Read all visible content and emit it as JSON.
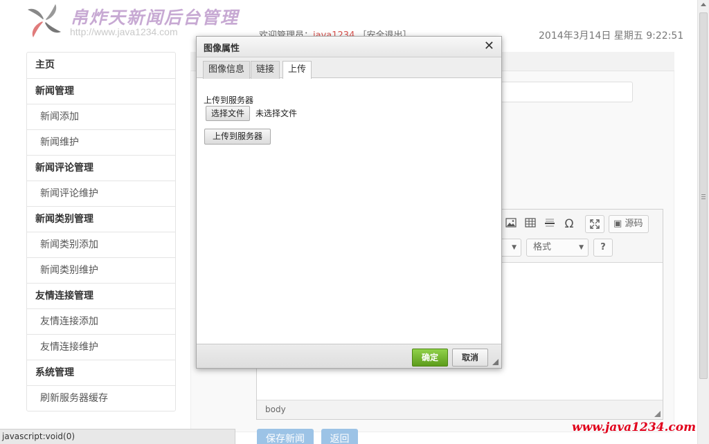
{
  "header": {
    "site_title": "帛炸天新闻后台管理",
    "site_url": "http://www.java1234.com",
    "welcome_prefix": "欢迎管理员：",
    "username": "java1234",
    "logout": "［安全退出］",
    "datetime": "2014年3月14日 星期五 9:22:51"
  },
  "sidebar": {
    "items": [
      {
        "label": "主页",
        "type": "group"
      },
      {
        "label": "新闻管理",
        "type": "group"
      },
      {
        "label": "新闻添加",
        "type": "sub"
      },
      {
        "label": "新闻维护",
        "type": "sub"
      },
      {
        "label": "新闻评论管理",
        "type": "group"
      },
      {
        "label": "新闻评论维护",
        "type": "sub"
      },
      {
        "label": "新闻类别管理",
        "type": "group"
      },
      {
        "label": "新闻类别添加",
        "type": "sub"
      },
      {
        "label": "新闻类别维护",
        "type": "sub"
      },
      {
        "label": "友情连接管理",
        "type": "group"
      },
      {
        "label": "友情连接添加",
        "type": "sub"
      },
      {
        "label": "友情连接维护",
        "type": "sub"
      },
      {
        "label": "系统管理",
        "type": "group"
      },
      {
        "label": "刷新服务器缓存",
        "type": "sub"
      }
    ]
  },
  "editor": {
    "source_label": "源码",
    "format_label": "格式",
    "help_label": "?",
    "path_label": "body"
  },
  "actions": {
    "save_label": "保存新闻",
    "back_label": "返回"
  },
  "dialog": {
    "title": "图像属性",
    "close": "✕",
    "tabs": [
      {
        "label": "图像信息",
        "active": false
      },
      {
        "label": "链接",
        "active": false
      },
      {
        "label": "上传",
        "active": true
      }
    ],
    "upload_label": "上传到服务器",
    "file_button": "选择文件",
    "file_status": "未选择文件",
    "upload_button": "上传到服务器",
    "ok_label": "确定",
    "cancel_label": "取消"
  },
  "statusbar": {
    "text": "javascript:void(0)"
  },
  "watermark": "www.java1234.com",
  "colors": {
    "accent_blue": "#9cc3e6",
    "ok_green": "#6bb02a",
    "username_red": "#d9534f",
    "watermark_red": "#e1001b"
  }
}
